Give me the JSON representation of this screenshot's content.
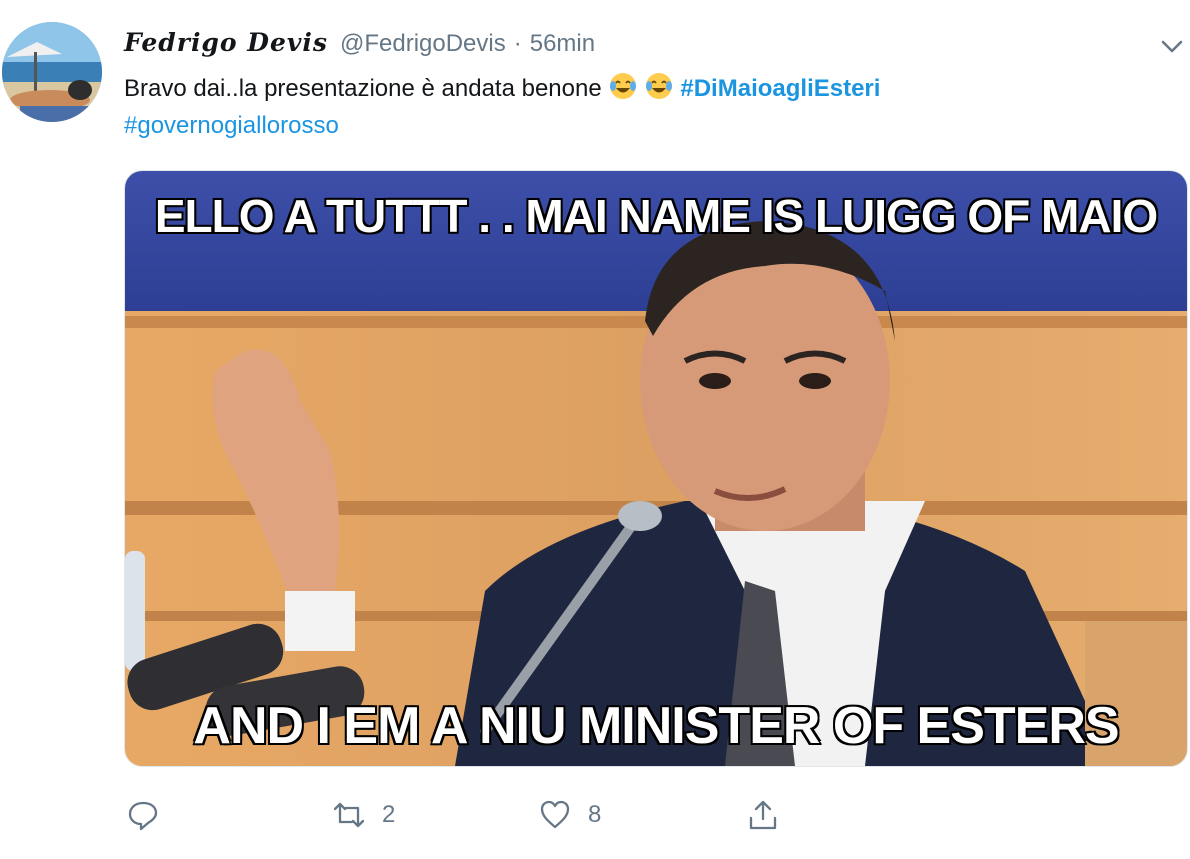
{
  "tweet": {
    "display_name": "Fedrigo Devis",
    "handle": "@FedrigoDevis",
    "separator": "·",
    "time": "56min",
    "text_main": "Bravo dai..la presentazione è andata benone",
    "hashtag_1": "#DiMaioagliEsteri",
    "hashtag_2": "#governogiallorosso",
    "emoji": [
      "face-with-tears-of-joy",
      "face-with-tears-of-joy"
    ]
  },
  "media": {
    "top_caption": "ELLO A TUTTT . .  MAI NAME IS LUIGG OF MAIO",
    "bottom_caption": "AND I EM A NIU MINISTER OF ESTERS"
  },
  "actions": {
    "reply_icon": "reply-icon",
    "retweet_icon": "retweet-icon",
    "retweet_count": "2",
    "like_icon": "heart-icon",
    "like_count": "8",
    "share_icon": "share-icon"
  },
  "colors": {
    "link": "#1b95e0",
    "muted": "#657786",
    "text": "#14171a"
  }
}
